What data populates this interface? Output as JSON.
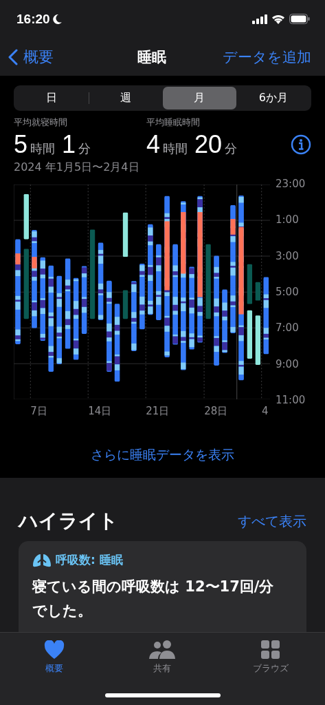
{
  "status_bar": {
    "time": "16:20"
  },
  "nav": {
    "back": "概要",
    "title": "睡眠",
    "action": "データを追加"
  },
  "segments": [
    {
      "label": "日",
      "selected": false
    },
    {
      "label": "週",
      "selected": false
    },
    {
      "label": "月",
      "selected": true
    },
    {
      "label": "6か月",
      "selected": false
    }
  ],
  "stats": [
    {
      "label": "平均就寝時間",
      "parts": [
        {
          "number": "5",
          "unit": "時間"
        },
        {
          "number": "1",
          "unit": "分"
        }
      ]
    },
    {
      "label": "平均睡眠時間",
      "parts": [
        {
          "number": "4",
          "unit": "時間"
        },
        {
          "number": "20",
          "unit": "分"
        }
      ]
    }
  ],
  "date_range": "2024 年1月5日〜2月4日",
  "chart": {
    "y_labels": [
      "23:00",
      "1:00",
      "3:00",
      "5:00",
      "7:00",
      "9:00",
      "11:00"
    ],
    "x_labels": [
      "7日",
      "14日",
      "21日",
      "28日",
      "4"
    ]
  },
  "more_link": "さらに睡眠データを表示",
  "highlights": {
    "title": "ハイライト",
    "see_all": "すべて表示",
    "card": {
      "title": "呼吸数: 睡眠",
      "text": "寝ている間の呼吸数は 12〜17回/分でした。"
    }
  },
  "tab_bar": [
    {
      "label": "概要",
      "selected": true
    },
    {
      "label": "共有",
      "selected": false
    },
    {
      "label": "ブラウズ",
      "selected": false
    }
  ]
}
